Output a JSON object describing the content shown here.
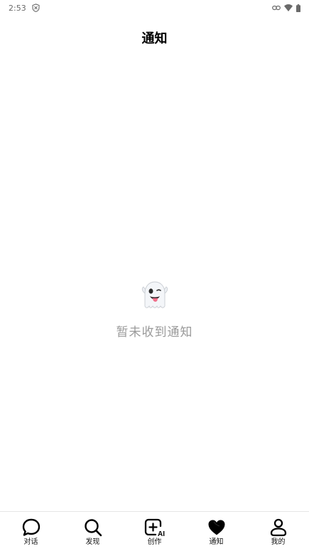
{
  "status_bar": {
    "time": "2:53",
    "icons": [
      "shield-icon",
      "link-icon",
      "wifi-icon",
      "battery-icon"
    ]
  },
  "header": {
    "title": "通知"
  },
  "empty_state": {
    "icon": "ghost-icon",
    "message": "暂未收到通知"
  },
  "bottom_nav": {
    "items": [
      {
        "label": "对话",
        "icon": "chat-bubble-icon",
        "active": false
      },
      {
        "label": "发现",
        "icon": "search-icon",
        "active": false
      },
      {
        "label": "创作",
        "icon": "create-ai-icon",
        "active": false
      },
      {
        "label": "通知",
        "icon": "heart-icon",
        "active": true
      },
      {
        "label": "我的",
        "icon": "person-icon",
        "active": false
      }
    ]
  }
}
